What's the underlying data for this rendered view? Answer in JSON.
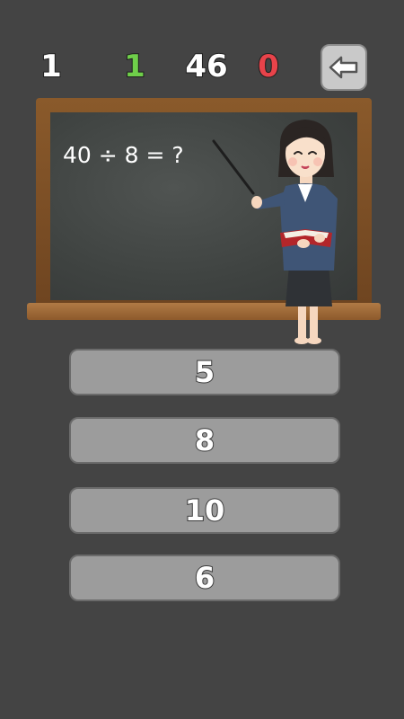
{
  "scoreboard": {
    "round": "1",
    "correct": "1",
    "time": "46",
    "wrong": "0"
  },
  "question": {
    "text": "40 ÷ 8 = ?"
  },
  "answers": [
    {
      "label": "5"
    },
    {
      "label": "8"
    },
    {
      "label": "10"
    },
    {
      "label": "6"
    }
  ],
  "icons": {
    "back": "back-arrow-icon",
    "teacher": "teacher-illustration"
  },
  "colors": {
    "background": "#444444",
    "correct": "#6fcf4a",
    "wrong": "#e8434a",
    "button": "#9c9c9c",
    "board": "#424644",
    "frame": "#7a4c25"
  }
}
